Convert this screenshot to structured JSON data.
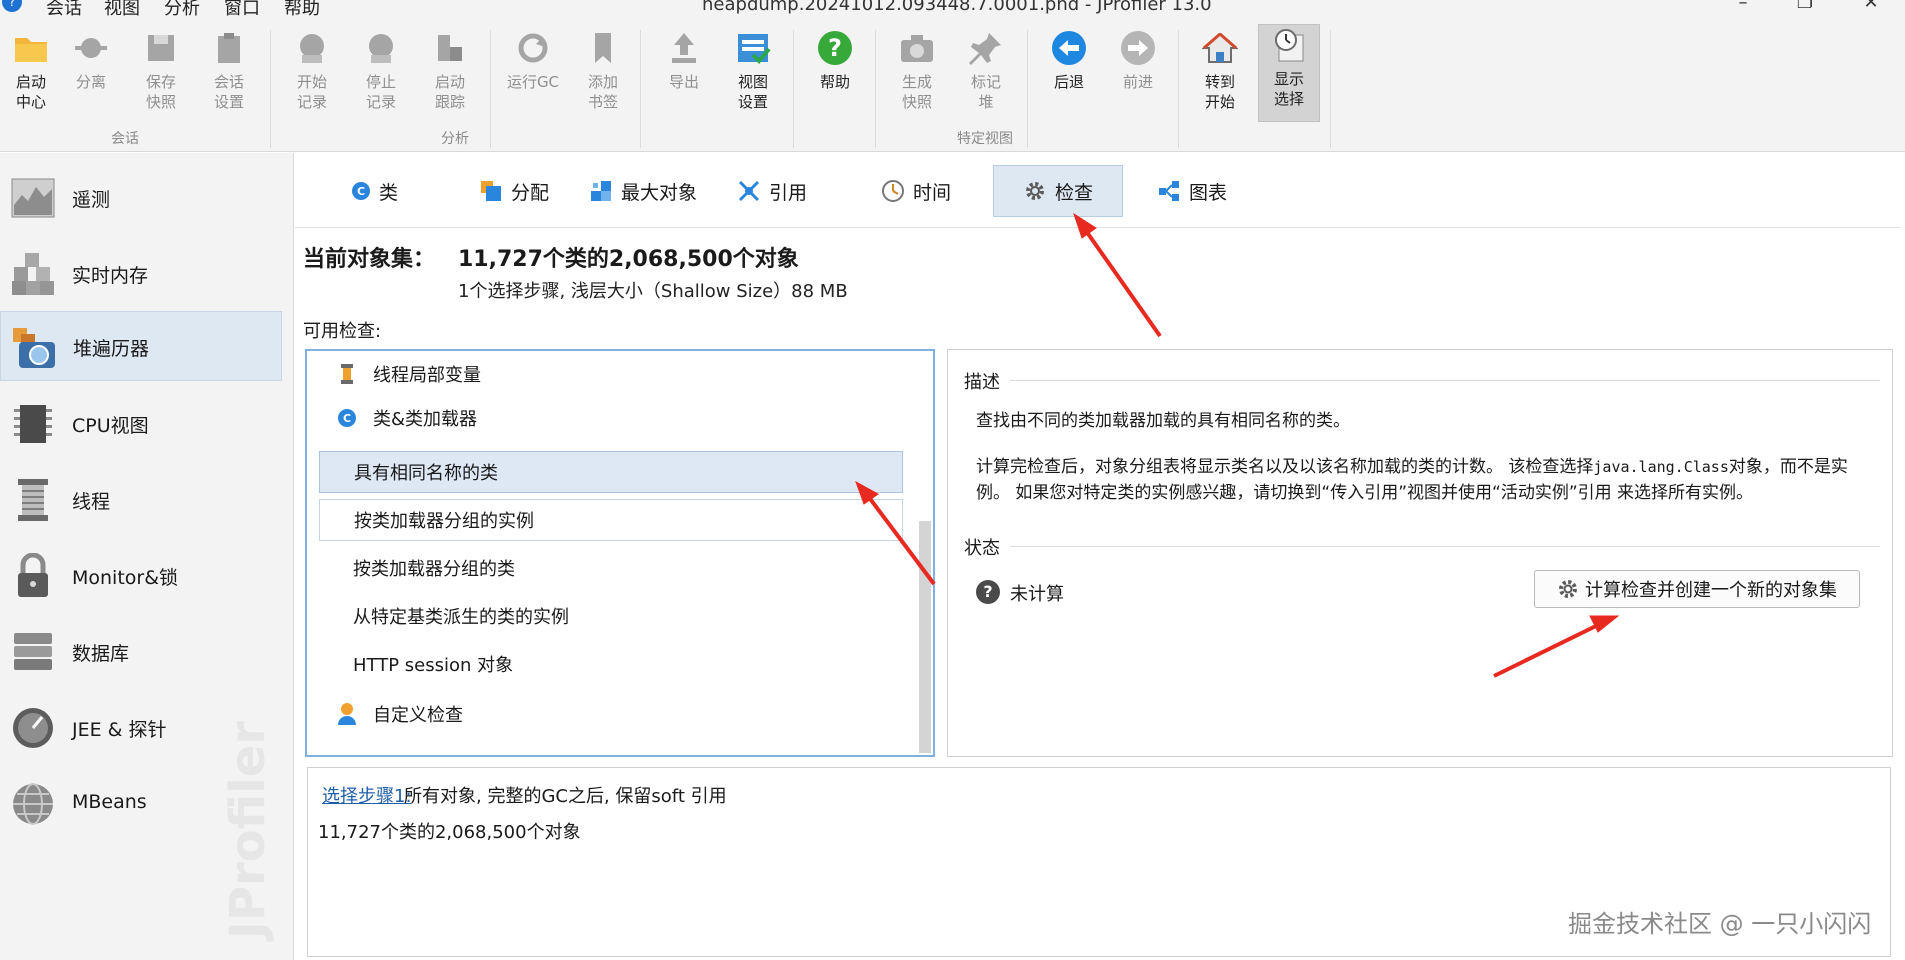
{
  "titlebar": {
    "menus": [
      "会话",
      "视图",
      "分析",
      "窗口",
      "帮助"
    ],
    "window_title": "heapdump.20241012.093448.7.0001.phd - JProfiler 13.0"
  },
  "ribbon": {
    "buttons": [
      {
        "label1": "启动",
        "label2": "中心"
      },
      {
        "label1": "分离",
        "label2": ""
      },
      {
        "label1": "保存",
        "label2": "快照"
      },
      {
        "label1": "会话",
        "label2": "设置"
      },
      {
        "label1": "开始",
        "label2": "记录"
      },
      {
        "label1": "停止",
        "label2": "记录"
      },
      {
        "label1": "启动",
        "label2": "跟踪"
      },
      {
        "label1": "运行GC",
        "label2": ""
      },
      {
        "label1": "添加",
        "label2": "书签"
      },
      {
        "label1": "导出",
        "label2": ""
      },
      {
        "label1": "视图",
        "label2": "设置"
      },
      {
        "label1": "帮助",
        "label2": ""
      },
      {
        "label1": "生成",
        "label2": "快照"
      },
      {
        "label1": "标记",
        "label2": "堆"
      },
      {
        "label1": "后退",
        "label2": ""
      },
      {
        "label1": "前进",
        "label2": ""
      },
      {
        "label1": "转到",
        "label2": "开始"
      },
      {
        "label1": "显示",
        "label2": "选择"
      }
    ],
    "groups": {
      "session": "会话",
      "analysis": "分析",
      "view": "特定视图"
    }
  },
  "sidebar": {
    "items": [
      {
        "label": "遥测"
      },
      {
        "label": "实时内存"
      },
      {
        "label": "堆遍历器"
      },
      {
        "label": "CPU视图"
      },
      {
        "label": "线程"
      },
      {
        "label": "Monitor&锁"
      },
      {
        "label": "数据库"
      },
      {
        "label": "JEE & 探针"
      },
      {
        "label": "MBeans"
      }
    ],
    "watermark": "JProfiler"
  },
  "tabs": [
    {
      "label": "类"
    },
    {
      "label": "分配"
    },
    {
      "label": "最大对象"
    },
    {
      "label": "引用"
    },
    {
      "label": "时间"
    },
    {
      "label": "检查"
    },
    {
      "label": "图表"
    }
  ],
  "current_set": {
    "label": "当前对象集：",
    "value": "11,727个类的2,068,500个对象",
    "sub": "1个选择步骤, 浅层大小（Shallow Size）88 MB"
  },
  "available_label": "可用检查:",
  "inspections": [
    {
      "label": "线程局部变量"
    },
    {
      "label": "类&类加载器"
    },
    {
      "label": "具有相同名称的类"
    },
    {
      "label": "按类加载器分组的实例"
    },
    {
      "label": "按类加载器分组的类"
    },
    {
      "label": "从特定基类派生的类的实例"
    },
    {
      "label": "HTTP session 对象"
    },
    {
      "label": "自定义检查"
    }
  ],
  "description": {
    "title": "描述",
    "text1": "查找由不同的类加载器加载的具有相同名称的类。",
    "text2a": "计算完检查后，对象分组表将显示类名以及以该名称加载的类的计数。 该检查选择",
    "text2_code": "java.lang.Class",
    "text2b": "对象，而不是实例。 如果您对特定类的实例感兴趣，请切换到“传入引用”视图并使用“活动实例”引用 来选择所有实例。"
  },
  "status": {
    "title": "状态",
    "text": "未计算",
    "button": "计算检查并创建一个新的对象集"
  },
  "step": {
    "link": "选择步骤1:",
    "text": "所有对象, 完整的GC之后, 保留soft 引用",
    "sub": "11,727个类的2,068,500个对象"
  },
  "corner_watermark": "掘金技术社区 @ 一只小闪闪",
  "colors": {
    "accent": "#1e73d2",
    "selection": "#dde8f4",
    "arrow": "#e8291f"
  }
}
